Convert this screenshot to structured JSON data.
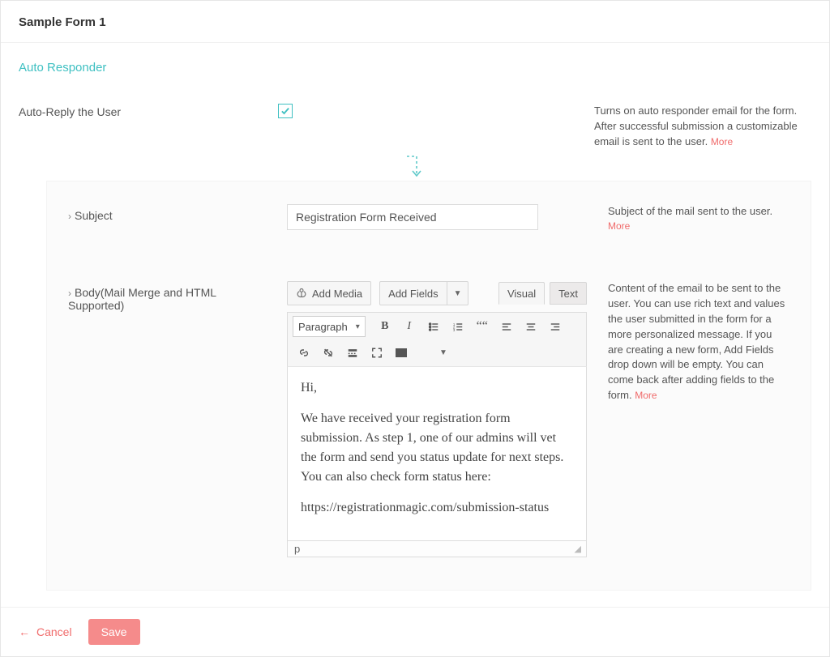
{
  "header": {
    "title": "Sample Form 1"
  },
  "section": {
    "title": "Auto Responder"
  },
  "autoreply": {
    "label": "Auto-Reply the User",
    "checked": true,
    "help": "Turns on auto responder email for the form. After successful submission a customizable email is sent to the user.",
    "more": "More"
  },
  "subject": {
    "label": "Subject",
    "value": "Registration Form Received",
    "help": "Subject of the mail sent to the user.",
    "more": "More"
  },
  "body": {
    "label": "Body(Mail Merge and HTML Supported)",
    "add_media": "Add Media",
    "add_fields": "Add Fields",
    "tabs": {
      "visual": "Visual",
      "text": "Text"
    },
    "format_select": "Paragraph",
    "content": {
      "p1": "Hi,",
      "p2": "We have received your registration form submission. As step 1, one of our admins will vet the form and send you status update for next steps. You can also check form status here:",
      "p3": "https://registrationmagic.com/submission-status"
    },
    "status_path": "p",
    "help": "Content of the email to be sent to the user. You can use rich text and values the user submitted in the form for a more personalized message. If you are creating a new form, Add Fields drop down will be empty. You can come back after adding fields to the form.",
    "more": "More"
  },
  "footer": {
    "cancel": "Cancel",
    "save": "Save"
  }
}
